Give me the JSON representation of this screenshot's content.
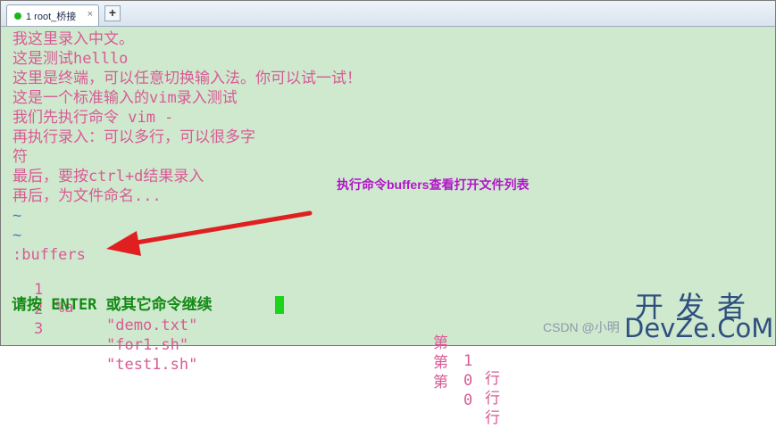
{
  "tabs": [
    {
      "label": "1 root_桥接",
      "close": "×"
    }
  ],
  "tab_add": "+",
  "terminal": {
    "lines": [
      "我这里录入中文。",
      "这是测试helllo",
      "这里是终端，可以任意切换输入法。你可以试一试！",
      "这是一个标准输入的vim录入测试",
      "我们先执行命令 vim -",
      "再执行录入：可以多行，可以很多字",
      "符",
      "最后，要按ctrl+d结果录入",
      "再后，为文件命名..."
    ],
    "tildes": [
      "~",
      "~"
    ],
    "command": ":buffers",
    "buffers": [
      {
        "num": "1",
        "flags": "%a",
        "name": "\"demo.txt\"",
        "line_label": "第",
        "line": "1",
        "line_unit": "行"
      },
      {
        "num": "2",
        "flags": "",
        "name": "\"for1.sh\"",
        "line_label": "第",
        "line": "0",
        "line_unit": "行"
      },
      {
        "num": "3",
        "flags": "",
        "name": "\"test1.sh\"",
        "line_label": "第",
        "line": "0",
        "line_unit": "行"
      }
    ],
    "prompt": "请按 ENTER 或其它命令继续"
  },
  "annotation": "执行命令buffers查看打开文件列表",
  "watermark": {
    "top": "开发者",
    "logo": "DevZe.CoM",
    "bottom": "CSDN @小明"
  },
  "colors": {
    "background": "#cfe9cf",
    "text": "#d85a94",
    "prompt": "#138a13",
    "cursor": "#1ed31e",
    "tilde": "#4a78c8",
    "annotation": "#b215c9",
    "arrow": "#e02020"
  }
}
